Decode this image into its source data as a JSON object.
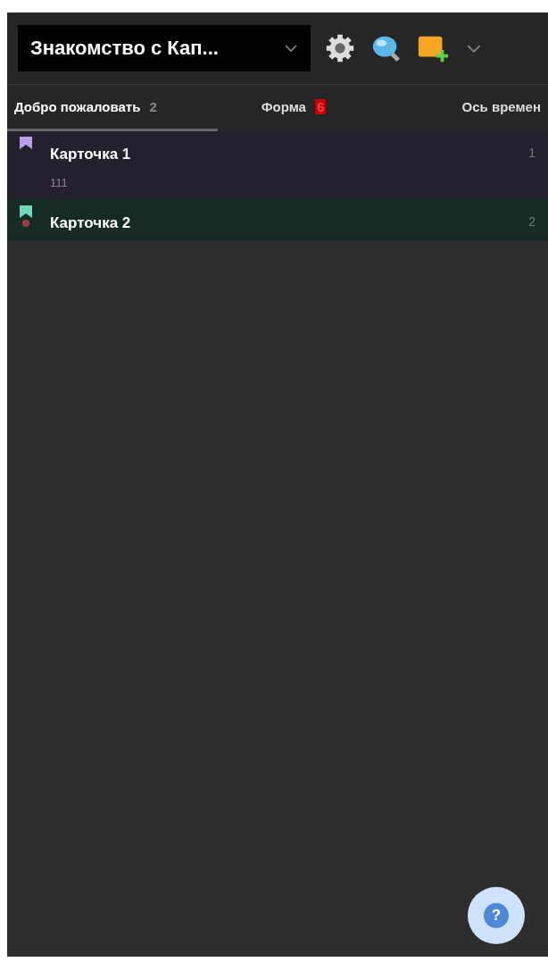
{
  "header": {
    "title": "Знакомство с Кап..."
  },
  "tabs": [
    {
      "label": "Добро пожаловать",
      "count": "2",
      "alert": false,
      "selected": true
    },
    {
      "label": "Форма",
      "count": "6",
      "alert": true,
      "selected": false
    },
    {
      "label": "Ось времен",
      "selected": false
    }
  ],
  "cards": [
    {
      "title": "Карточка 1",
      "note": "111",
      "number": "1",
      "color": "#b9a0e8",
      "marked": false
    },
    {
      "title": "Карточка 2",
      "number": "2",
      "color": "#6fd8b8",
      "marked": true
    }
  ],
  "help_button": {
    "label": "?"
  }
}
